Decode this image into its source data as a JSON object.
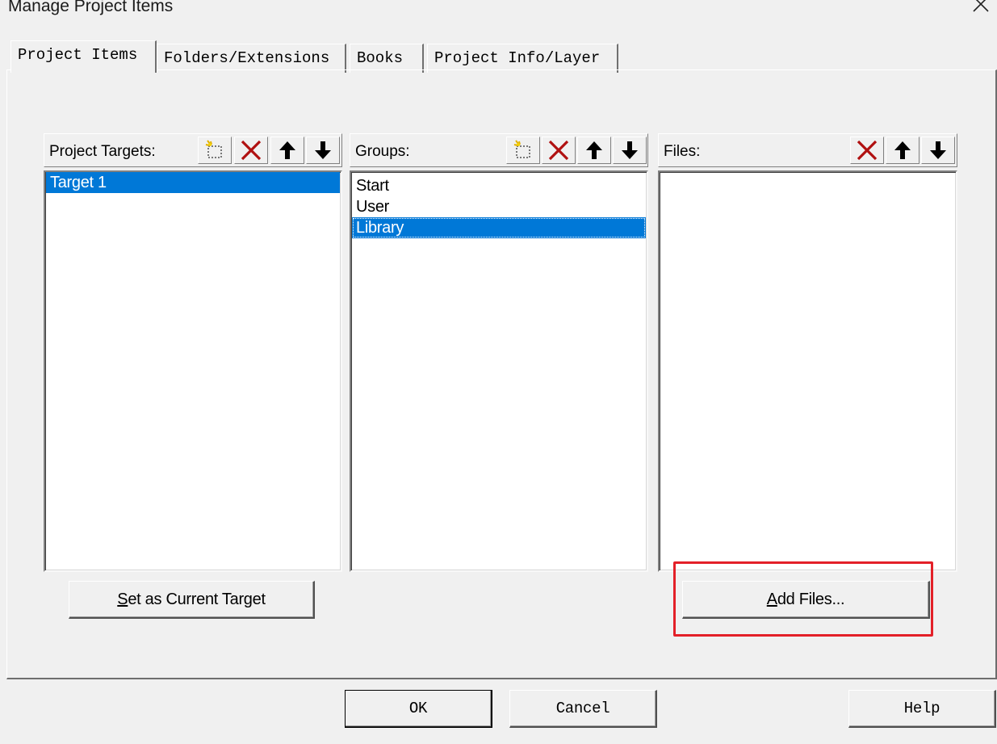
{
  "window": {
    "title": "Manage Project Items"
  },
  "tabs": [
    {
      "label": "Project Items",
      "active": true
    },
    {
      "label": "Folders/Extensions",
      "active": false
    },
    {
      "label": "Books",
      "active": false
    },
    {
      "label": "Project Info/Layer",
      "active": false
    }
  ],
  "targets": {
    "header": "Project Targets:",
    "toolbar": [
      "new-icon",
      "delete-icon",
      "move-up-icon",
      "move-down-icon"
    ],
    "items": [
      {
        "label": "Target 1",
        "selected": true
      }
    ],
    "set_current_button": {
      "accesskey": "S",
      "rest": "et as Current Target"
    }
  },
  "groups": {
    "header": "Groups:",
    "toolbar": [
      "new-icon",
      "delete-icon",
      "move-up-icon",
      "move-down-icon"
    ],
    "items": [
      {
        "label": "Start",
        "selected": false
      },
      {
        "label": "User",
        "selected": false
      },
      {
        "label": "Library",
        "selected": true
      }
    ]
  },
  "files": {
    "header": "Files:",
    "toolbar": [
      "delete-icon",
      "move-up-icon",
      "move-down-icon"
    ],
    "items": [],
    "add_files_button": {
      "accesskey": "A",
      "rest": "dd Files..."
    }
  },
  "footer": {
    "ok": "OK",
    "cancel": "Cancel",
    "help": "Help"
  },
  "colors": {
    "selection": "#0078d7",
    "highlight": "#e32028",
    "delete_icon": "#b01010"
  }
}
